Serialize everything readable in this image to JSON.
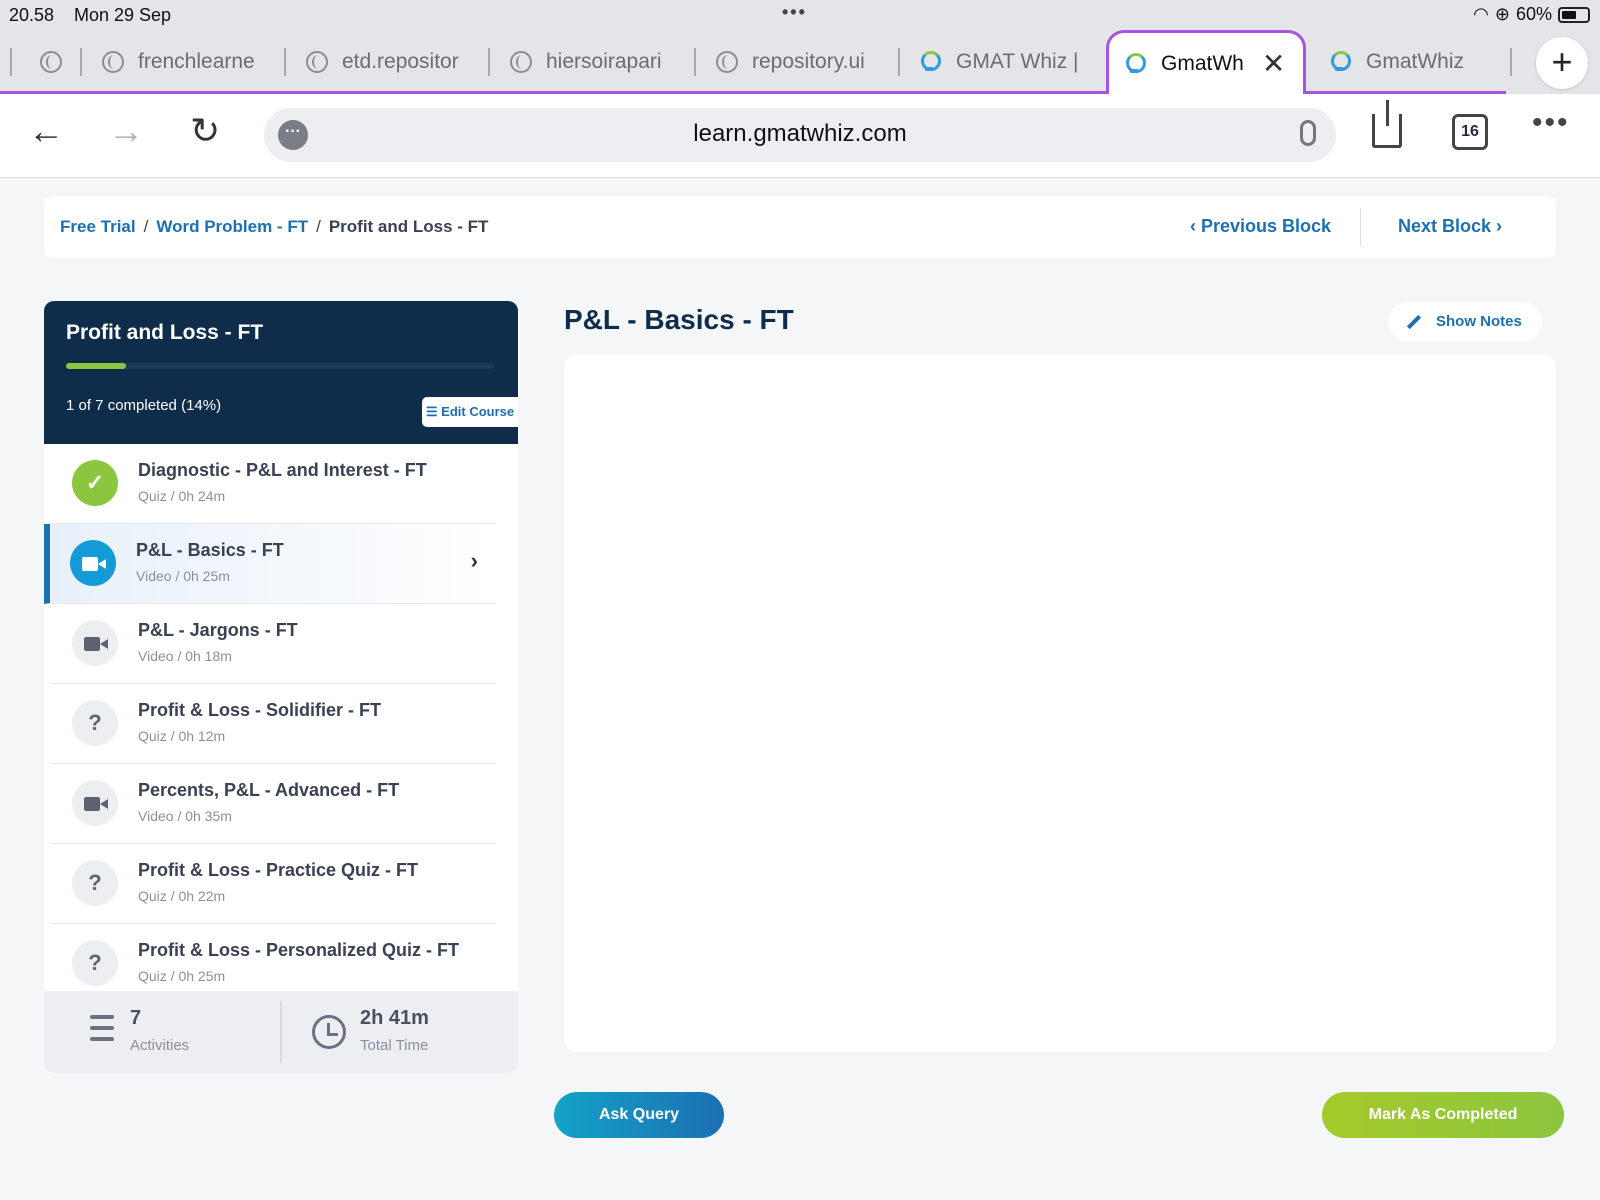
{
  "status": {
    "time": "20.58",
    "date": "Mon 29 Sep",
    "battery": "60%",
    "battery_level": 0.6
  },
  "browser": {
    "tabs": [
      {
        "label": "frenchlearne",
        "icon": "globe-icon"
      },
      {
        "label": "etd.repositor",
        "icon": "globe-icon"
      },
      {
        "label": "hiersoirapari",
        "icon": "globe-icon"
      },
      {
        "label": "repository.ui",
        "icon": "globe-icon"
      },
      {
        "label": "GMAT Whiz |",
        "icon": "gmatwhiz-icon"
      },
      {
        "label": "GmatWh",
        "icon": "gmatwhiz-icon",
        "active": true
      },
      {
        "label": "GmatWhiz",
        "icon": "gmatwhiz-icon"
      }
    ],
    "url": "learn.gmatwhiz.com",
    "tab_count": "16",
    "group_color": "#a754e0"
  },
  "breadcrumb": {
    "items": [
      "Free Trial",
      "Word Problem - FT",
      "Profit and Loss - FT"
    ],
    "prev": "Previous Block",
    "next": "Next Block"
  },
  "course": {
    "title": "Profit and Loss - FT",
    "progress_text": "1 of 7 completed (14%)",
    "progress_fraction": 0.14,
    "edit_label": "Edit Course",
    "items": [
      {
        "name": "Diagnostic - P&L and Interest - FT",
        "meta": "Quiz / 0h 24m",
        "type": "quiz",
        "completed": true
      },
      {
        "name": "P&L - Basics - FT",
        "meta": "Video / 0h 25m",
        "type": "video",
        "active": true
      },
      {
        "name": "P&L - Jargons - FT",
        "meta": "Video / 0h 18m",
        "type": "video"
      },
      {
        "name": "Profit & Loss - Solidifier - FT",
        "meta": "Quiz / 0h 12m",
        "type": "quiz"
      },
      {
        "name": "Percents, P&L - Advanced - FT",
        "meta": "Video / 0h 35m",
        "type": "video"
      },
      {
        "name": "Profit & Loss - Practice Quiz - FT",
        "meta": "Quiz / 0h 22m",
        "type": "quiz"
      },
      {
        "name": "Profit & Loss - Personalized Quiz - FT",
        "meta": "Quiz / 0h 25m",
        "type": "quiz"
      }
    ],
    "footer": {
      "activities_count": "7",
      "activities_label": "Activities",
      "total_time": "2h 41m",
      "total_time_label": "Total Time"
    }
  },
  "main": {
    "title": "P&L - Basics - FT",
    "show_notes": "Show Notes",
    "ask_query": "Ask Query",
    "mark_completed": "Mark As Completed"
  },
  "colors": {
    "accent": "#1c6fb3",
    "success": "#8cc63f",
    "header_bg": "#0f2d4b"
  }
}
